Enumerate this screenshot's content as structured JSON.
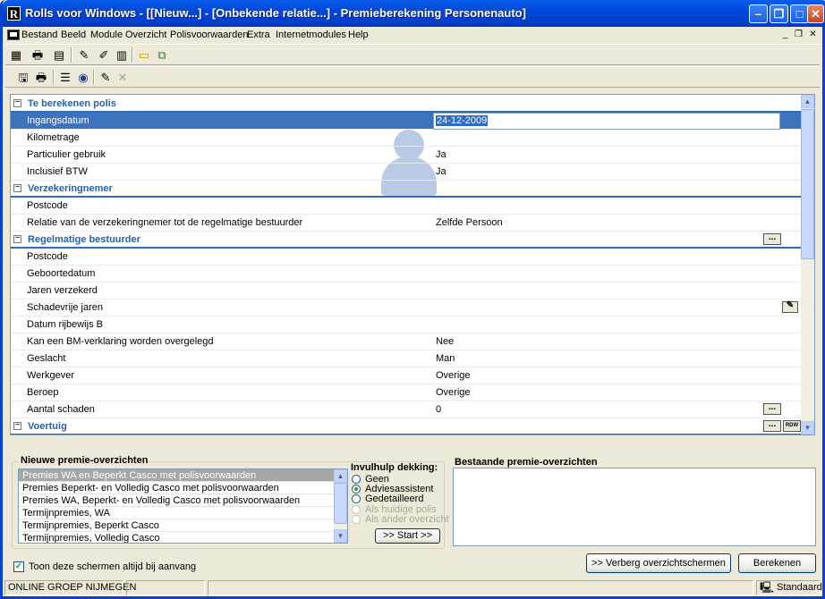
{
  "window": {
    "title": "Rolls voor Windows - [[Nieuw...] - [Onbekende relatie...] - Premieberekening Personenauto]",
    "app_icon_letter": "R"
  },
  "menu": [
    "Bestand",
    "Beeld",
    "Module",
    "Overzicht",
    "Polisvoorwaarden",
    "Extra",
    "Internetmodules",
    "Help"
  ],
  "grid": {
    "sections": {
      "polis": "Te berekenen polis",
      "verzekeringnemer": "Verzekeringnemer",
      "bestuurder": "Regelmatige bestuurder",
      "voertuig": "Voertuig"
    },
    "rows": {
      "ingangsdatum": {
        "label": "Ingangsdatum",
        "value": "24-12-2009"
      },
      "kilometrage": {
        "label": "Kilometrage",
        "value": ""
      },
      "particulier": {
        "label": "Particulier gebruik",
        "value": "Ja"
      },
      "btw": {
        "label": "Inclusief BTW",
        "value": "Ja"
      },
      "postcode1": {
        "label": "Postcode",
        "value": ""
      },
      "relatie": {
        "label": "Relatie van de verzekeringnemer tot de regelmatige bestuurder",
        "value": "Zelfde Persoon"
      },
      "postcode2": {
        "label": "Postcode",
        "value": ""
      },
      "geboortedatum": {
        "label": "Geboortedatum",
        "value": ""
      },
      "jaren": {
        "label": "Jaren verzekerd",
        "value": ""
      },
      "schadevrije": {
        "label": "Schadevrije jaren",
        "value": ""
      },
      "rijbewijs": {
        "label": "Datum rijbewijs B",
        "value": ""
      },
      "bm": {
        "label": "Kan een BM-verklaring worden overgelegd",
        "value": "Nee"
      },
      "geslacht": {
        "label": "Geslacht",
        "value": "Man"
      },
      "werkgever": {
        "label": "Werkgever",
        "value": "Overige"
      },
      "beroep": {
        "label": "Beroep",
        "value": "Overige"
      },
      "schaden": {
        "label": "Aantal schaden",
        "value": "0"
      }
    },
    "ellipsis": "...",
    "toggle": "−",
    "rdw_label": "RDW"
  },
  "new_overviews": {
    "title": "Nieuwe premie-overzichten",
    "items": [
      "Premies  WA en Beperkt Casco met polisvoorwaarden",
      "Premies Beperkt- en Volledig Casco met polisvoorwaarden",
      "Premies WA, Beperkt- en Volledig Casco met polisvoorwaarden",
      "Termijnpremies,  WA",
      "Termijnpremies, Beperkt Casco",
      "Termijnpremies, Volledig Casco"
    ]
  },
  "help": {
    "title": "Invulhulp dekking:",
    "options": [
      "Geen",
      "Adviesassistent",
      "Gedetailleerd",
      "Als huidige polis",
      "Als ander overzicht"
    ],
    "start_label": ">> Start >>"
  },
  "existing": {
    "title": "Bestaande premie-overzichten"
  },
  "checkbox": {
    "label": "Toon deze schermen altijd bij aanvang",
    "checked": true
  },
  "buttons": {
    "hide": ">> Verberg overzichtschermen",
    "calculate": "Berekenen"
  },
  "status": {
    "left": "ONLINE GROEP  NIJMEGEN",
    "right": "Standaard"
  },
  "colors": {
    "title_bar": "#0346D8",
    "section_title": "#2462B0",
    "selection": "#3D72BD"
  }
}
